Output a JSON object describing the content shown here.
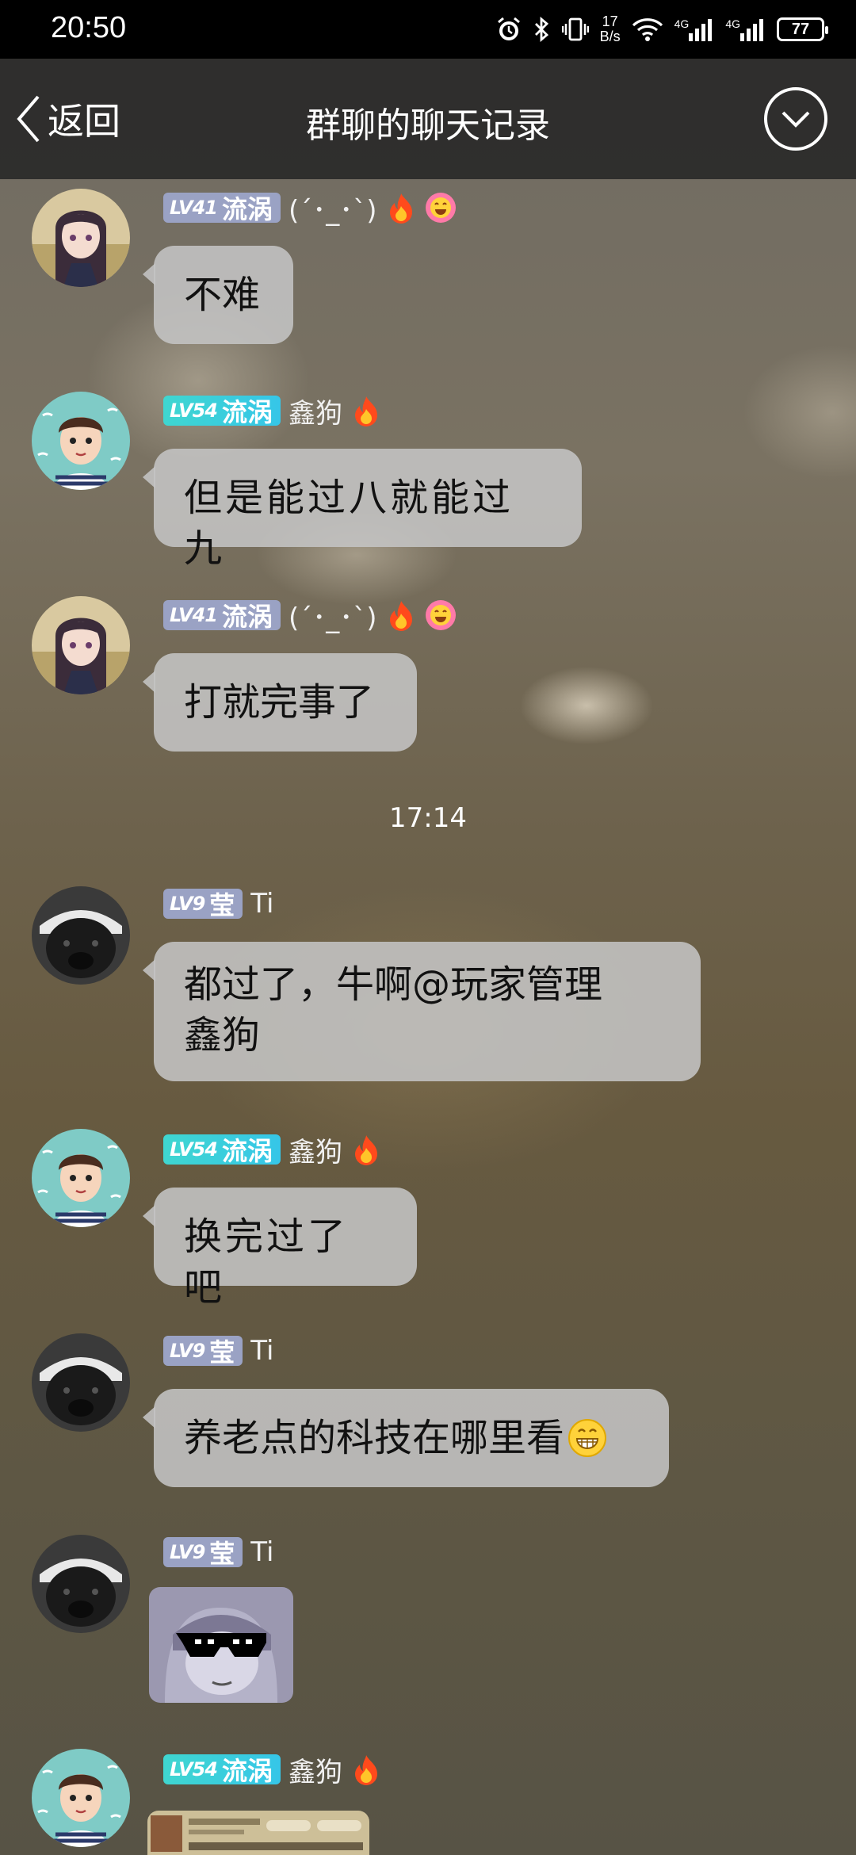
{
  "status_bar": {
    "time": "20:50",
    "net_speed_value": "17",
    "net_speed_unit": "B/s",
    "signal1": "4G",
    "signal2": "4G",
    "battery": "77"
  },
  "header": {
    "back_label": "返回",
    "title": "群聊的聊天记录"
  },
  "messages": [
    {
      "level": "LV41",
      "title": "流涡",
      "nickname": "(´･_･`)",
      "text": "不难",
      "badge_color": "lavender"
    },
    {
      "level": "LV54",
      "title": "流涡",
      "nickname": "鑫狗",
      "text": "但是能过八就能过九",
      "badge_color": "cyan"
    },
    {
      "level": "LV41",
      "title": "流涡",
      "nickname": "(´･_･`)",
      "text": "打就完事了",
      "badge_color": "lavender"
    },
    {
      "level": "LV9",
      "title": "莹",
      "nickname": "Ti",
      "text_line1": "都过了，牛啊@玩家管理",
      "text_line2": "鑫狗",
      "badge_color": "lavender"
    },
    {
      "level": "LV54",
      "title": "流涡",
      "nickname": "鑫狗",
      "text": "换完过了吧",
      "badge_color": "cyan"
    },
    {
      "level": "LV9",
      "title": "莹",
      "nickname": "Ti",
      "text": "养老点的科技在哪里看",
      "badge_color": "lavender"
    },
    {
      "level": "LV9",
      "title": "莹",
      "nickname": "Ti",
      "badge_color": "lavender"
    },
    {
      "level": "LV54",
      "title": "流涡",
      "nickname": "鑫狗",
      "badge_color": "cyan"
    }
  ],
  "timestamp": "17:14",
  "colors": {
    "bubble": "#c4c4c4",
    "badge_lavender": "#9aa2c4",
    "badge_cyan": "#3fd6d0",
    "header_bg": "#282828"
  }
}
